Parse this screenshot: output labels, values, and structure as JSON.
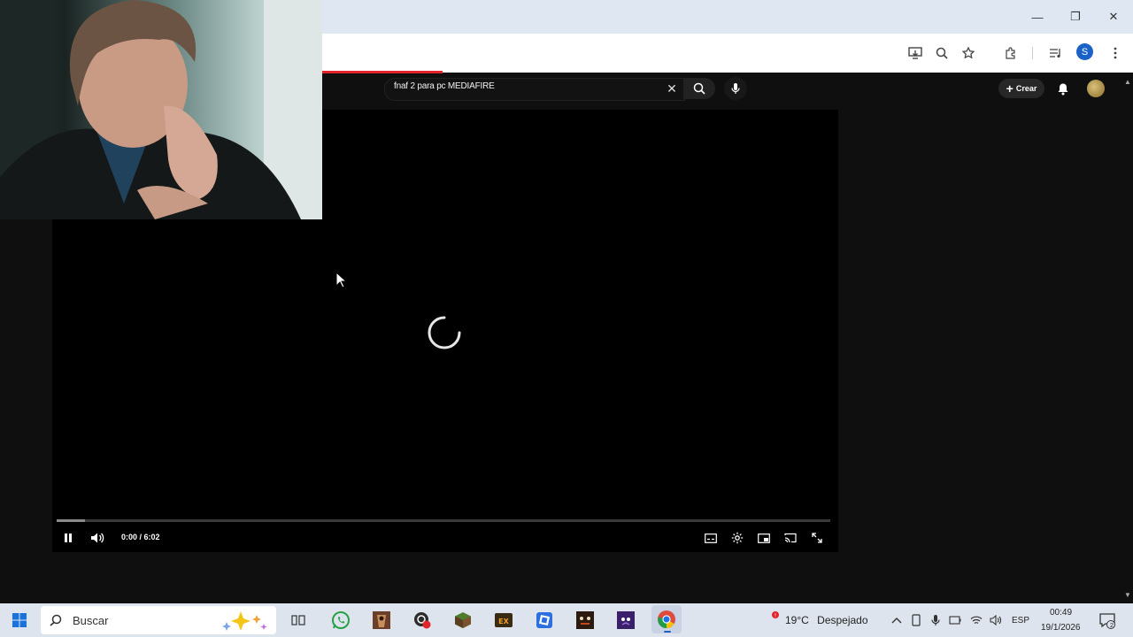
{
  "browser": {
    "window_controls": [
      "minimize",
      "restore",
      "close"
    ],
    "toolbar_icons": [
      "install-app-icon",
      "zoom-icon",
      "bookmark-star-icon",
      "extensions-icon",
      "media-controls-icon",
      "profile-icon",
      "menu-icon"
    ],
    "profile_letter": "S"
  },
  "youtube": {
    "search": {
      "query": "fnaf 2 para pc MEDIAFIRE"
    },
    "create_label": "Crear",
    "colors": {
      "accent": "#e0252d",
      "background": "#0f0f0f"
    }
  },
  "player": {
    "state": "loading",
    "time": "0:00 / 6:02",
    "progress_fraction": 0.0
  },
  "taskbar": {
    "search_label": "Buscar",
    "weather": {
      "temp": "19°C",
      "condition": "Despejado"
    },
    "language": "ESP",
    "time": "00:49",
    "date": "19/1/2026",
    "notification_count": "2"
  }
}
